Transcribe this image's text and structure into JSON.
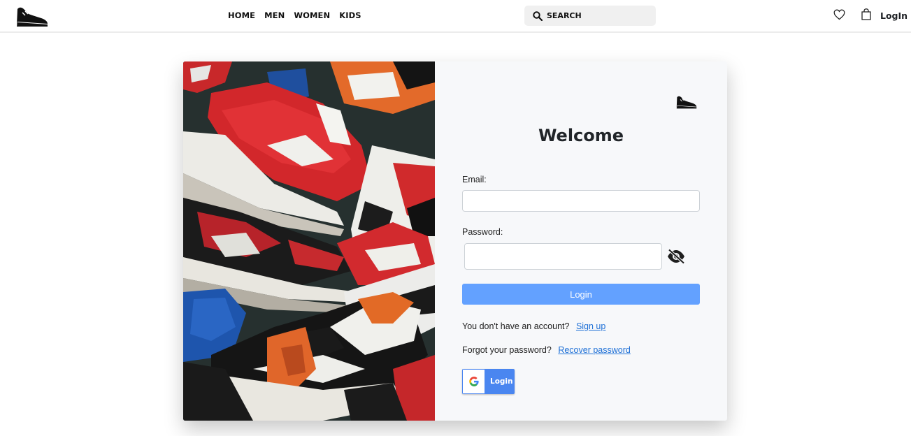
{
  "navbar": {
    "logo_icon": "sneaker-logo-icon",
    "links": [
      "HOME",
      "MEN",
      "WOMEN",
      "KIDS"
    ],
    "search_label": "SEARCH",
    "search_icon": "search-icon",
    "wishlist_icon": "heart-icon",
    "cart_icon": "shopping-bag-icon",
    "login_label": "LogIn"
  },
  "login_card": {
    "hero_image": "sneakers-pile-image",
    "title": "Welcome",
    "email_label": "Email:",
    "email_value": "",
    "password_label": "Password:",
    "password_value": "",
    "password_toggle_icon": "eye-slash-icon",
    "login_button": "Login",
    "signup_prompt": "You don't have an account?",
    "signup_link": "Sign up",
    "forgot_prompt": "Forgot your password?",
    "recover_link": "Recover password",
    "google_button": "Login",
    "google_icon": "google-icon"
  },
  "colors": {
    "primary_button": "#63a1ff",
    "google_button": "#4a86f0",
    "link": "#1d6fd6",
    "card_background": "#f7f8fa"
  }
}
